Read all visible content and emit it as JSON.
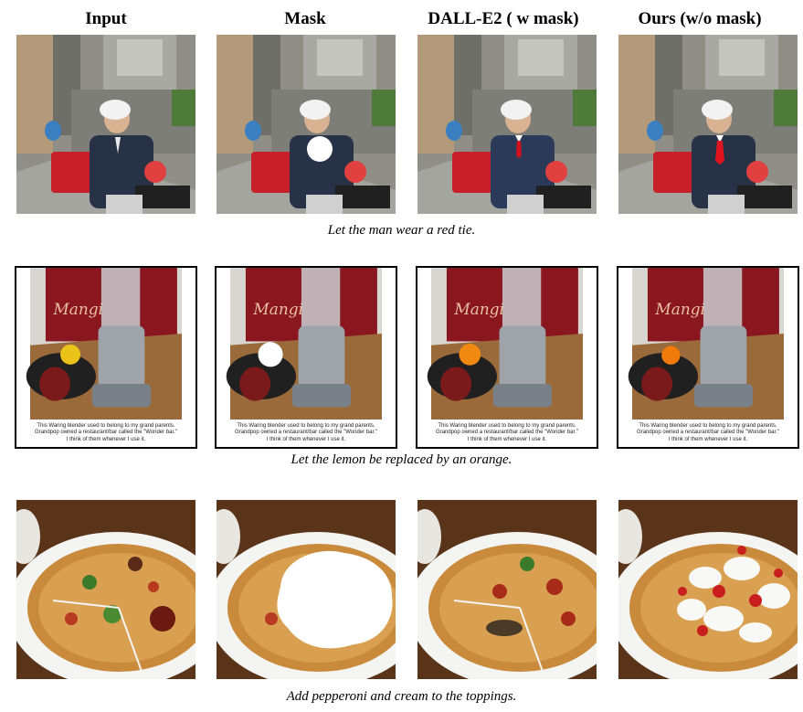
{
  "columns": [
    "Input",
    "Mask",
    "DALL-E2 ( w mask)",
    "Ours (w/o mask)"
  ],
  "rows": [
    {
      "caption": "Let the man wear a red tie."
    },
    {
      "caption": "Let the lemon be replaced by an orange.",
      "photo_text": [
        "This Waring blender used to belong to my grand parents.",
        "Grandpop owned a restaurant/bar called the \"Wonder bar.\"",
        "I think of them whenever I use it."
      ],
      "sign_text": "Mangi"
    },
    {
      "caption": "Add pepperoni and cream to the toppings."
    }
  ],
  "colors": {
    "tie_red": "#d0101c",
    "lemon": "#e9c21a",
    "orange": "#f08a12",
    "mask": "#ffffff",
    "scooter_red": "#c8202a",
    "pizza_crust": "#c98a3c",
    "sign_red": "#8a1620"
  }
}
